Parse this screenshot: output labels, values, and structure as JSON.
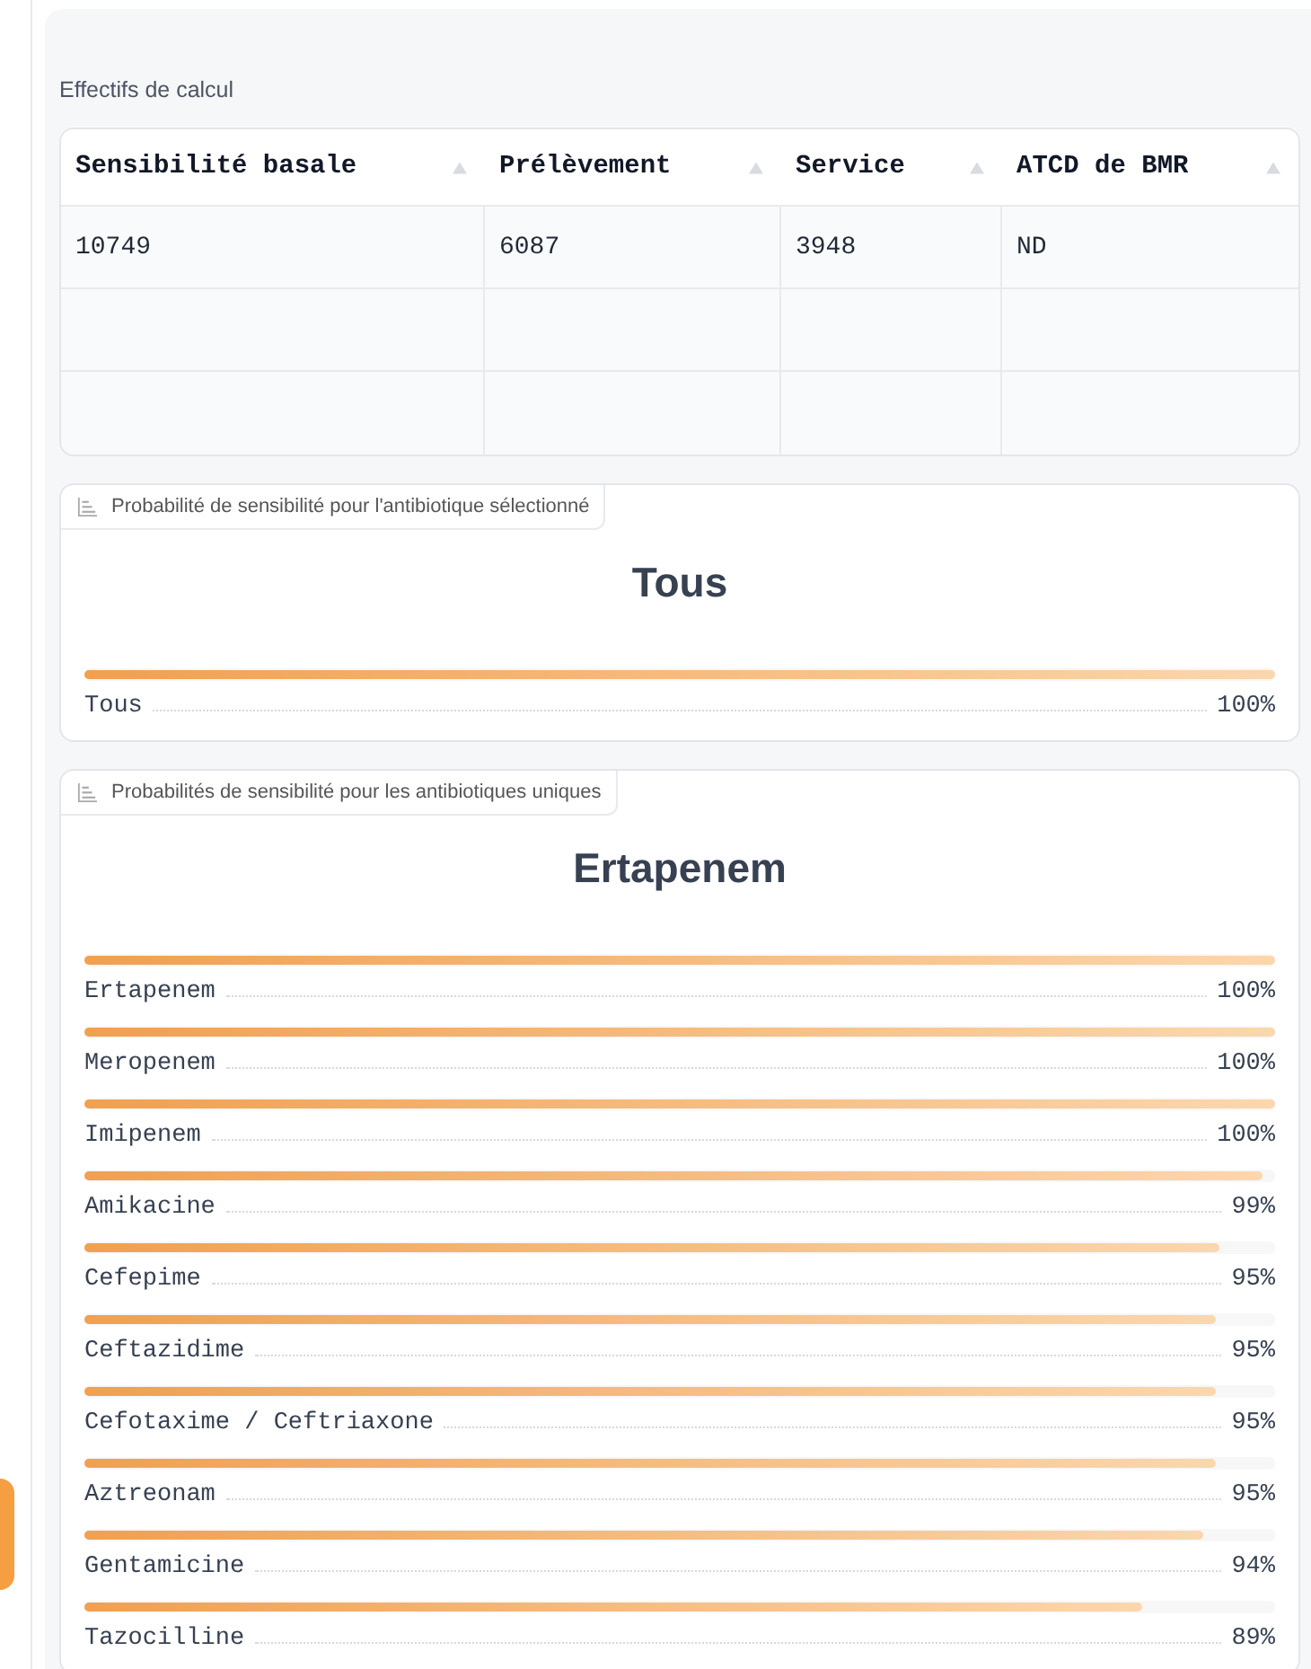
{
  "dataframe": {
    "label": "Effectifs de calcul",
    "columns": [
      "Sensibilité basale",
      "Prélèvement",
      "Service",
      "ATCD de BMR"
    ],
    "rows": [
      [
        "10749",
        "6087",
        "3948",
        "ND"
      ]
    ]
  },
  "label_panels": [
    {
      "label": "Probabilité de sensibilité pour l'antibiotique sélectionné",
      "title": "Tous",
      "confidences": [
        {
          "name": "Tous",
          "value": "100%",
          "level": 1
        }
      ]
    },
    {
      "label": "Probabilités de sensibilité pour les antibiotiques uniques",
      "title": "Ertapenem",
      "confidences": [
        {
          "name": "Ertapenem",
          "value": "100%",
          "level": 1
        },
        {
          "name": "Meropenem",
          "value": "100%",
          "level": 1
        },
        {
          "name": "Imipenem",
          "value": "100%",
          "level": 1
        },
        {
          "name": "Amikacine",
          "value": "99%",
          "level": 0.99
        },
        {
          "name": "Cefepime",
          "value": "95%",
          "level": 0.953
        },
        {
          "name": "Ceftazidime",
          "value": "95%",
          "level": 0.95
        },
        {
          "name": "Cefotaxime / Ceftriaxone",
          "value": "95%",
          "level": 0.95
        },
        {
          "name": "Aztreonam",
          "value": "95%",
          "level": 0.95
        },
        {
          "name": "Gentamicine",
          "value": "94%",
          "level": 0.94
        },
        {
          "name": "Tazocilline",
          "value": "89%",
          "level": 0.888
        }
      ]
    }
  ]
}
